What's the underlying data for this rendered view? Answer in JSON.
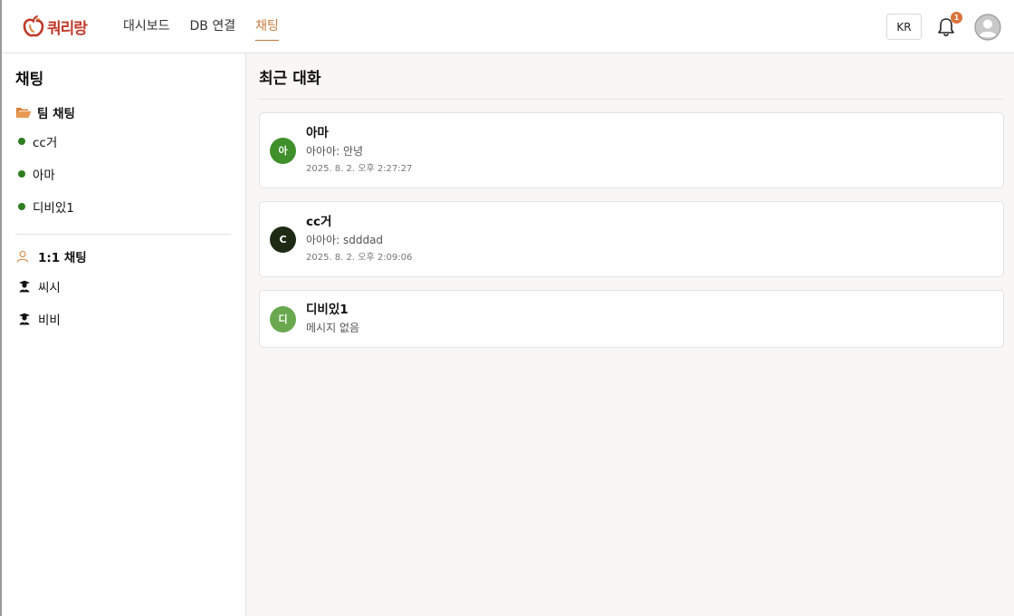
{
  "header": {
    "logo_text": "쿼리랑",
    "nav": [
      {
        "label": "대시보드",
        "active": false
      },
      {
        "label": "DB 연결",
        "active": false
      },
      {
        "label": "채팅",
        "active": true
      }
    ],
    "lang_label": "KR",
    "notification_count": "1"
  },
  "sidebar": {
    "title": "채팅",
    "team_group_label": "팀 채팅",
    "team_rooms": [
      {
        "label": "cc거"
      },
      {
        "label": "아마"
      },
      {
        "label": "디비있1"
      }
    ],
    "dm_group_label": "1:1 채팅",
    "dm_users": [
      {
        "label": "씨시"
      },
      {
        "label": "비비"
      }
    ]
  },
  "main": {
    "title": "최근 대화",
    "conversations": [
      {
        "avatar_letter": "아",
        "avatar_color": "#3f8f2a",
        "name": "아마",
        "message": "아아아: 안녕",
        "time": "2025. 8. 2. 오후 2:27:27"
      },
      {
        "avatar_letter": "C",
        "avatar_color": "#1f2a14",
        "name": "cc거",
        "message": "아아아: sdddad",
        "time": "2025. 8. 2. 오후 2:09:06"
      },
      {
        "avatar_letter": "디",
        "avatar_color": "#6aa84f",
        "name": "디비있1",
        "message": "메시지 없음",
        "time": ""
      }
    ]
  },
  "colors": {
    "accent": "#c97b3c",
    "online_dot": "#2e7d20",
    "badge": "#d9733b",
    "logo": "#c0392b"
  },
  "icons": {
    "logo": "apple-logo-icon",
    "notification": "bell-icon",
    "profile": "user-avatar-icon",
    "team_group": "folder-open-icon",
    "dm_group": "person-outline-icon",
    "dm_user": "graduate-user-icon"
  }
}
